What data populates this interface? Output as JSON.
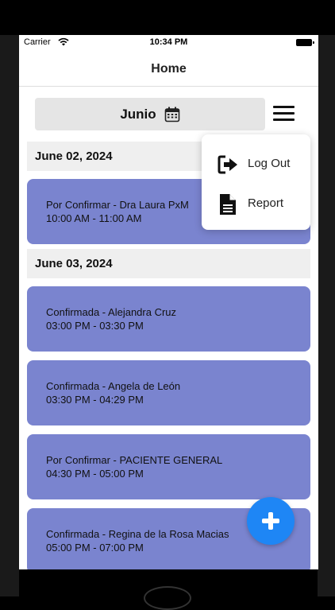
{
  "status_bar": {
    "carrier": "Carrier",
    "time": "10:34 PM"
  },
  "nav": {
    "title": "Home"
  },
  "month_selector": {
    "label": "Junio"
  },
  "menu": {
    "items": [
      {
        "label": "Log Out",
        "icon": "logout-icon"
      },
      {
        "label": "Report",
        "icon": "document-icon"
      }
    ]
  },
  "groups": [
    {
      "date": "June 02, 2024",
      "appointments": [
        {
          "title": "Por Confirmar - Dra Laura PxM",
          "time": "10:00 AM - 11:00 AM"
        }
      ]
    },
    {
      "date": "June 03, 2024",
      "appointments": [
        {
          "title": "Confirmada - Alejandra Cruz",
          "time": "03:00 PM - 03:30 PM"
        },
        {
          "title": "Confirmada - Angela de León",
          "time": "03:30 PM - 04:29 PM"
        },
        {
          "title": "Por Confirmar - PACIENTE GENERAL",
          "time": "04:30 PM - 05:00 PM"
        },
        {
          "title": "Confirmada - Regina de la Rosa Macias",
          "time": "05:00 PM - 07:00 PM"
        }
      ]
    }
  ],
  "colors": {
    "card": "#7a84cf",
    "fab": "#1e86f5",
    "header": "#efefef"
  }
}
